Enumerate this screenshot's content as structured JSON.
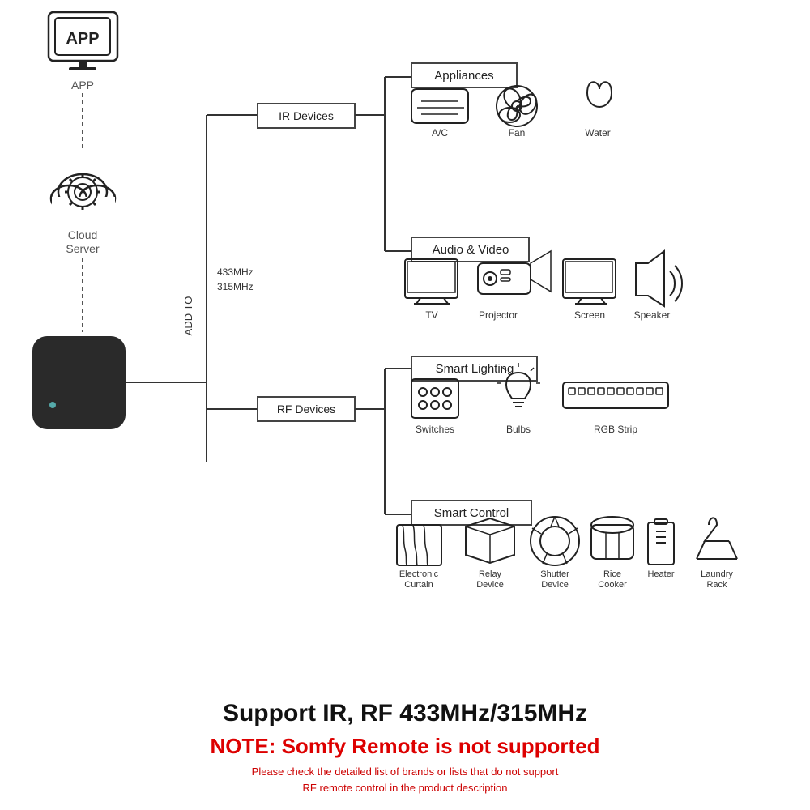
{
  "app": {
    "label": "APP",
    "icon_text": "APP"
  },
  "cloud": {
    "label_line1": "Cloud",
    "label_line2": "Server"
  },
  "ir_box": {
    "label": "IR Devices"
  },
  "rf_box": {
    "label": "RF Devices"
  },
  "add_to": "ADD TO",
  "frequencies": "433MHz\n315MHz",
  "categories": {
    "appliances": "Appliances",
    "audio_video": "Audio & Video",
    "smart_lighting": "Smart Lighting",
    "smart_control": "Smart Control"
  },
  "ir_devices": [
    {
      "name": "A/C"
    },
    {
      "name": "Fan"
    },
    {
      "name": "Water"
    },
    {
      "name": "TV"
    },
    {
      "name": "Projector"
    },
    {
      "name": "Screen"
    },
    {
      "name": "Speaker"
    }
  ],
  "rf_devices": [
    {
      "name": "Switches"
    },
    {
      "name": "Bulbs"
    },
    {
      "name": "RGB Strip"
    },
    {
      "name": "Electronic\nCurtain"
    },
    {
      "name": "Relay\nDevice"
    },
    {
      "name": "Shutter\nDevice"
    },
    {
      "name": "Rice\nCooker"
    },
    {
      "name": "Heater"
    },
    {
      "name": "Laundry\nRack"
    }
  ],
  "bottom": {
    "support_text": "Support IR, RF 433MHz/315MHz",
    "note_text": "NOTE: Somfy Remote is not supported",
    "sub_text": "Please check the detailed list of brands or lists that do not support\nRF remote control in the product description"
  }
}
